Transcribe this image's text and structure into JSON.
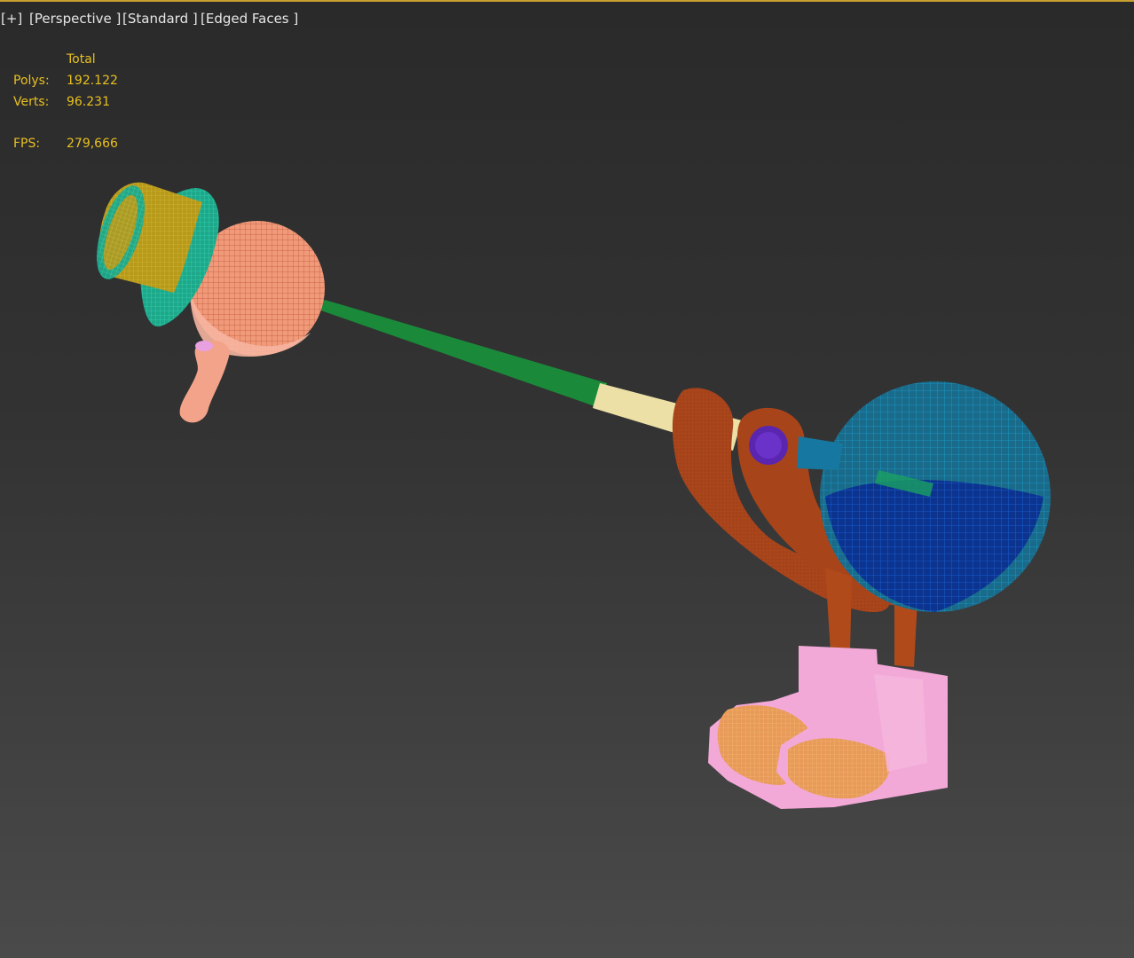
{
  "viewport_menu": {
    "plus": "[+]",
    "view": "[Perspective ]",
    "shading": "[Standard ]",
    "edges": "[Edged Faces ]"
  },
  "stats": {
    "header": "Total",
    "polys_label": "Polys:",
    "polys_value": "192.122",
    "verts_label": "Verts:",
    "verts_value": "96.231",
    "fps_label": "FPS:",
    "fps_value": "279,666"
  },
  "colors": {
    "stats_text": "#e8c020",
    "active_border": "#c8a030",
    "hat": "#2fc9a8",
    "hat_inner": "#c2a21e",
    "head": "#f09a7a",
    "nose": "#f2a38a",
    "pole_green": "#1a8a3a",
    "pole_cream": "#ece0a6",
    "body_blue": "#1678a0",
    "body_dark_blue": "#0a3aa0",
    "legs": "#a8441a",
    "eye": "#5a26b0",
    "boots": "#f2a9d8",
    "boots_inner": "#f0a860"
  },
  "scene": {
    "icons": [
      "top-hat-icon",
      "head-sphere-icon",
      "pole-icon",
      "body-sphere-icon",
      "legs-icon",
      "boots-icon"
    ]
  }
}
